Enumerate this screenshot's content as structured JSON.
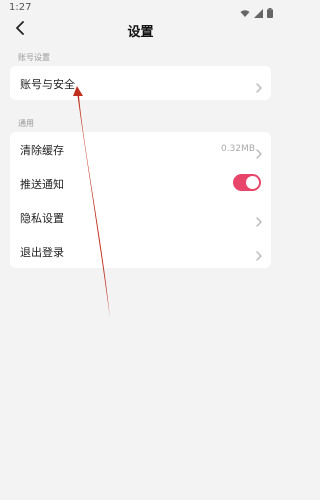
{
  "status_bar": {
    "time": "1:27",
    "icons": [
      "wifi-icon",
      "cellular-signal-icon",
      "battery-icon"
    ]
  },
  "header": {
    "title": "设置",
    "back_icon": "back-arrow-icon"
  },
  "sections": {
    "account": {
      "label": "账号设置",
      "items": [
        {
          "label": "账号与安全",
          "icon": "chevron-right-icon"
        }
      ]
    },
    "general": {
      "label": "通用",
      "items": [
        {
          "label": "清除缓存",
          "value": "0.32MB",
          "icon": "chevron-right-icon"
        },
        {
          "label": "推送通知",
          "toggle_on": true
        },
        {
          "label": "隐私设置",
          "icon": "chevron-right-icon"
        },
        {
          "label": "退出登录",
          "icon": "chevron-right-icon"
        }
      ]
    }
  },
  "colors": {
    "background": "#f3f3f3",
    "card": "#ffffff",
    "toggle_on": "#e8456b",
    "annotation_arrow": "#c0301e"
  }
}
